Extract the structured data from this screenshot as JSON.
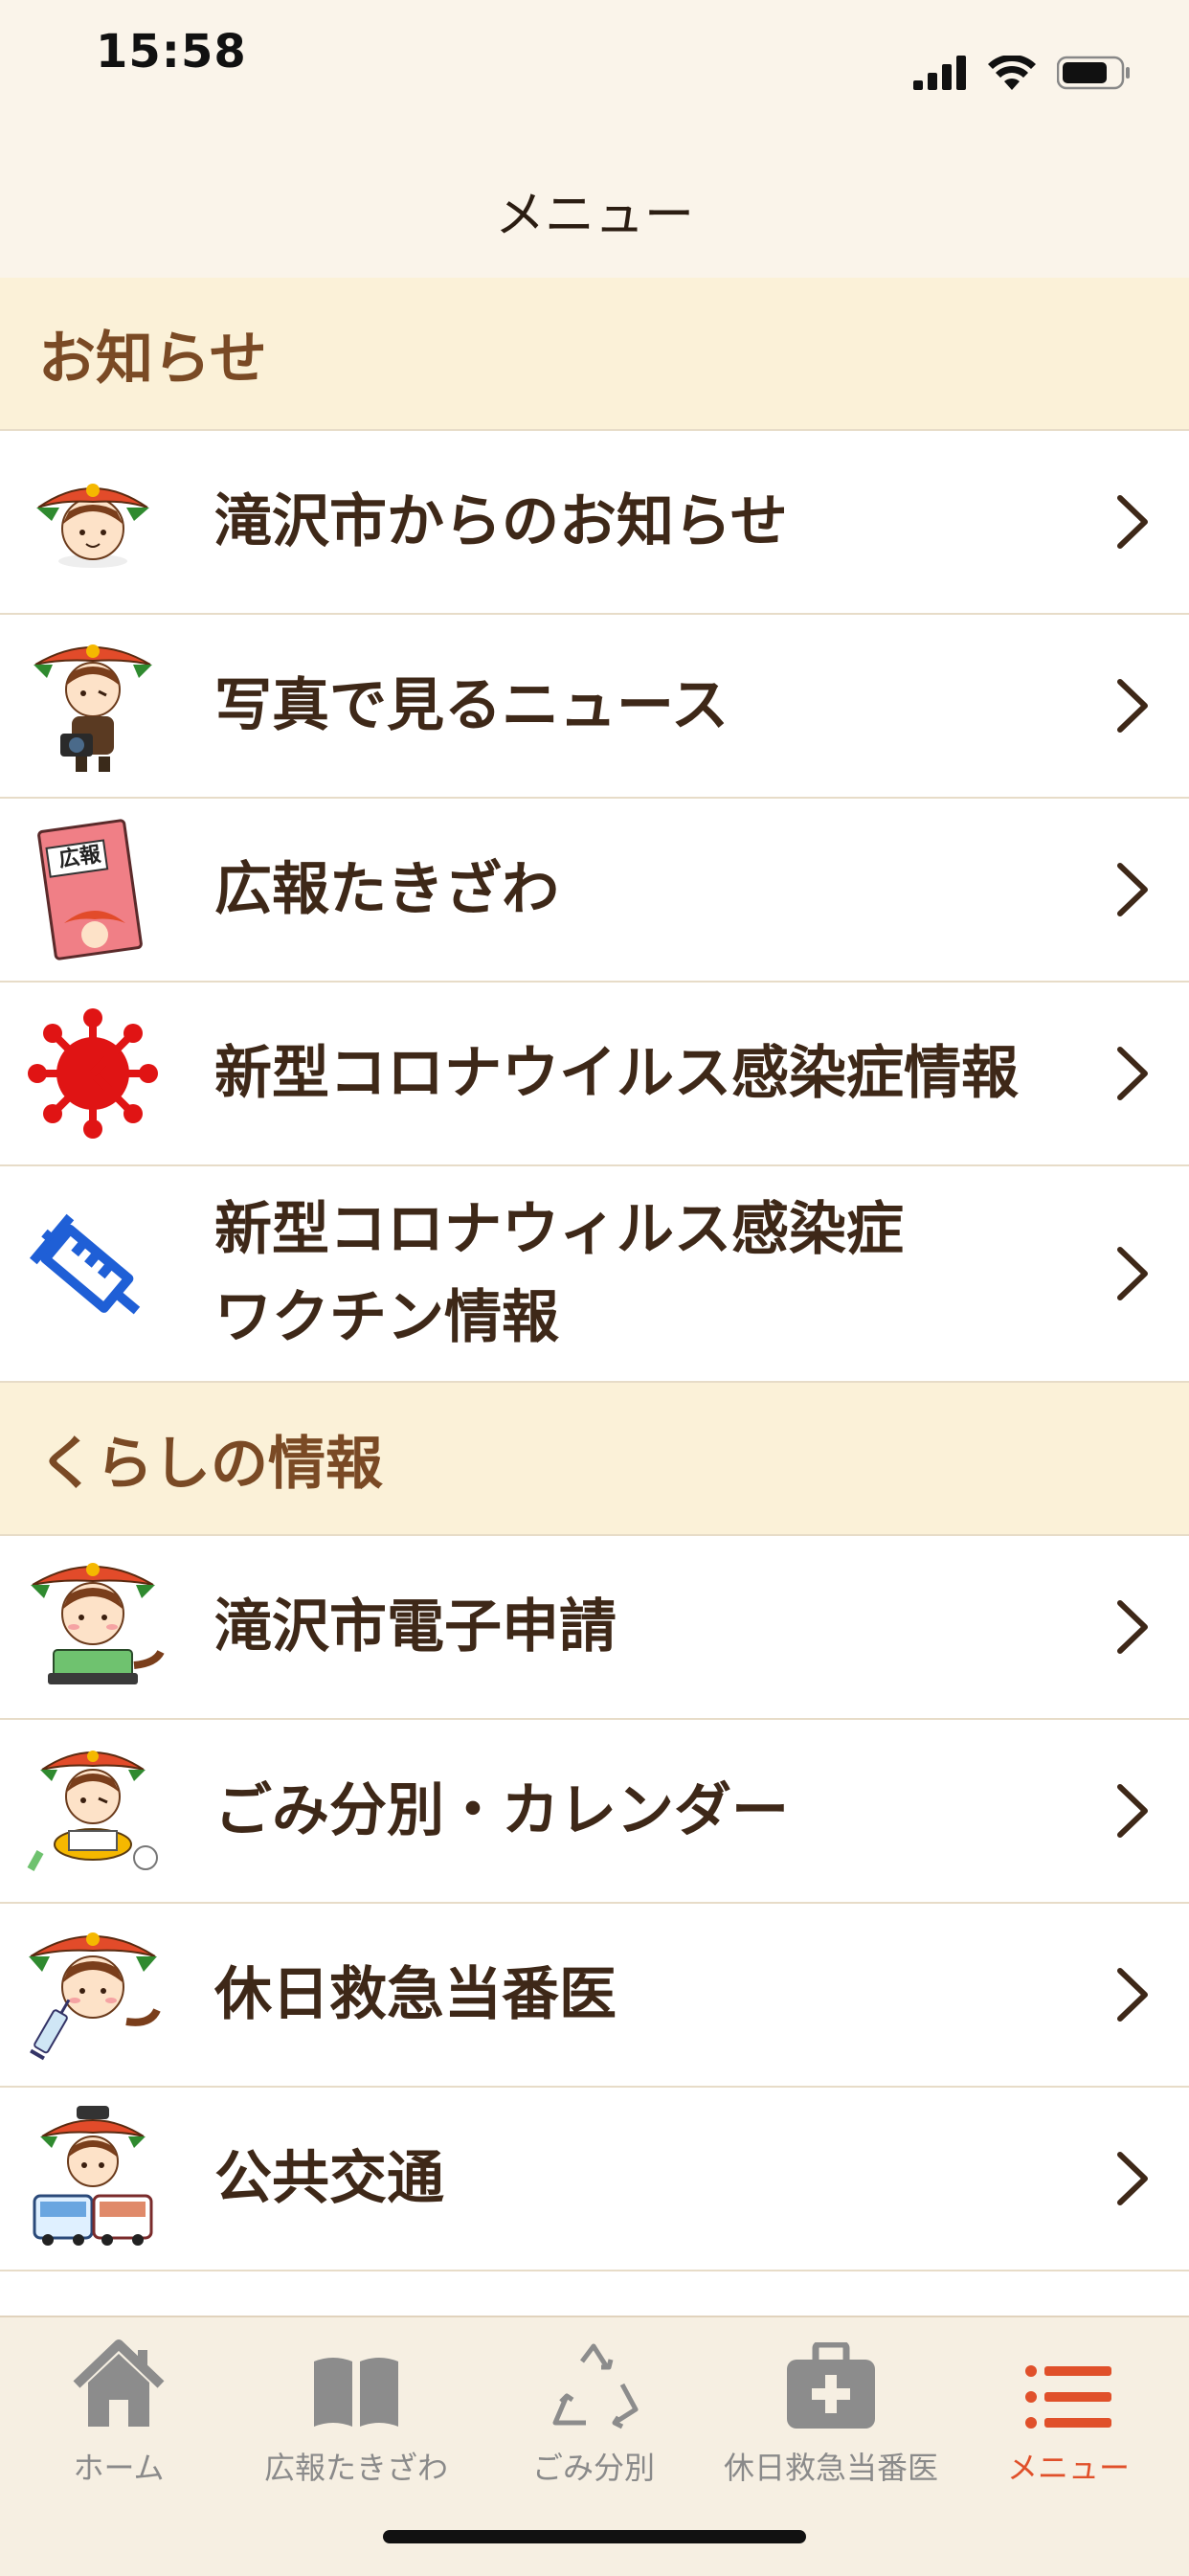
{
  "status_bar": {
    "time": "15:58"
  },
  "nav": {
    "title": "メニュー"
  },
  "sections": [
    {
      "title": "お知らせ",
      "items": [
        {
          "label": "滝沢市からのお知らせ",
          "icon": "mascot-face-icon"
        },
        {
          "label": "写真で見るニュース",
          "icon": "mascot-camera-icon"
        },
        {
          "label": "広報たきざわ",
          "icon": "newsletter-book-icon",
          "badge_text": "広報"
        },
        {
          "label": "新型コロナウイルス感染症情報",
          "icon": "virus-icon"
        },
        {
          "label": "新型コロナウィルス感染症\nワクチン情報",
          "icon": "syringe-icon"
        }
      ]
    },
    {
      "title": "くらしの情報",
      "items": [
        {
          "label": "滝沢市電子申請",
          "icon": "mascot-laptop-icon"
        },
        {
          "label": "ごみ分別・カレンダー",
          "icon": "mascot-recycle-icon"
        },
        {
          "label": "休日救急当番医",
          "icon": "mascot-syringe-icon"
        },
        {
          "label": "公共交通",
          "icon": "mascot-bus-icon"
        }
      ]
    }
  ],
  "tabs": [
    {
      "label": "ホーム",
      "icon": "home-icon",
      "active": false
    },
    {
      "label": "広報たきざわ",
      "icon": "book-icon",
      "active": false
    },
    {
      "label": "ごみ分別",
      "icon": "recycle-icon",
      "active": false
    },
    {
      "label": "休日救急当番医",
      "icon": "medical-kit-icon",
      "active": false
    },
    {
      "label": "メニュー",
      "icon": "menu-list-icon",
      "active": true
    }
  ],
  "colors": {
    "accent": "#e0502a",
    "section_bg": "#fbf1d8",
    "background": "#faf4ea",
    "text": "#3e2818"
  }
}
